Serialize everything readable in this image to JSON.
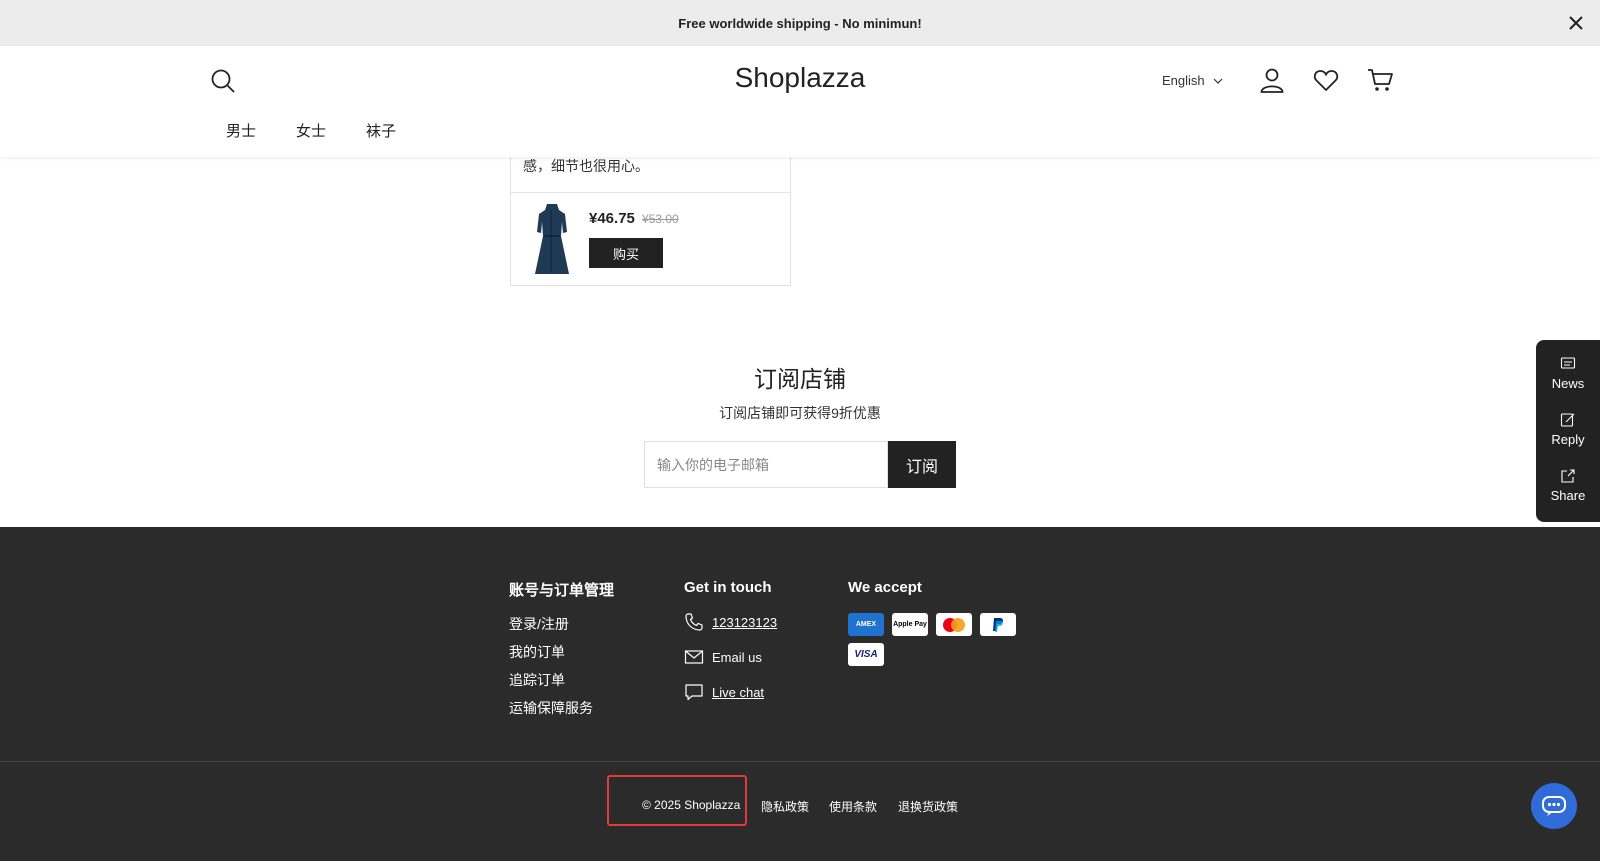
{
  "announcement": {
    "text": "Free worldwide shipping - No minimun!"
  },
  "header": {
    "logo": "Shoplazza",
    "language": "English",
    "nav": [
      "男士",
      "女士",
      "袜子"
    ]
  },
  "review": {
    "text_partial": "感，细节也很用心。",
    "price_now": "¥46.75",
    "price_old": "¥53.00",
    "buy_label": "购买"
  },
  "subscribe": {
    "title": "订阅店铺",
    "description": "订阅店铺即可获得9折优惠",
    "placeholder": "输入你的电子邮箱",
    "button_label": "订阅"
  },
  "side_panel": {
    "items": [
      {
        "label": "News",
        "icon": "message-icon"
      },
      {
        "label": "Reply",
        "icon": "edit-icon"
      },
      {
        "label": "Share",
        "icon": "share-icon"
      }
    ]
  },
  "footer": {
    "account": {
      "title": "账号与订单管理",
      "links": [
        "登录/注册",
        "我的订单",
        "追踪订单",
        "运输保障服务"
      ]
    },
    "contact": {
      "title": "Get in touch",
      "phone": "123123123",
      "email": "Email us",
      "chat": "Live chat"
    },
    "payments": {
      "title": "We accept",
      "methods": [
        "AMEX",
        "Apple Pay",
        "Mastercard",
        "PayPal",
        "VISA"
      ]
    },
    "copyright": "© 2025 Shoplazza",
    "policies": [
      "隐私政策",
      "使用条款",
      "退换货政策"
    ]
  },
  "colors": {
    "accent": "#2f6bd9",
    "footer_bg": "#2b2b2b",
    "highlight": "#e03a3a"
  }
}
